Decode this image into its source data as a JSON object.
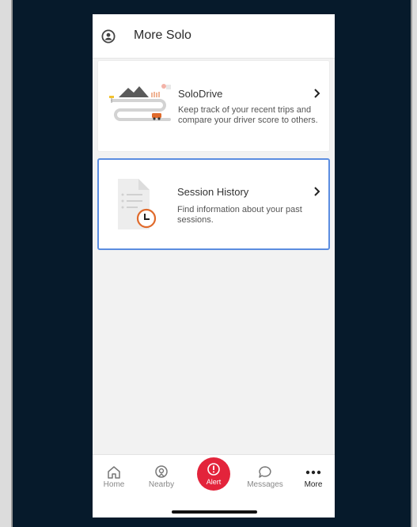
{
  "header": {
    "title": "More Solo"
  },
  "cards": [
    {
      "title": "SoloDrive",
      "description": "Keep track of your recent trips and compare your driver score to others."
    },
    {
      "title": "Session History",
      "description": "Find information about your past sessions."
    }
  ],
  "tabs": {
    "home": "Home",
    "nearby": "Nearby",
    "alert": "Alert",
    "messages": "Messages",
    "more": "More"
  },
  "colors": {
    "alert": "#e3243b",
    "selection_border": "#5b8de0",
    "clock_accent": "#e06a2b",
    "background": "#061a2b"
  }
}
